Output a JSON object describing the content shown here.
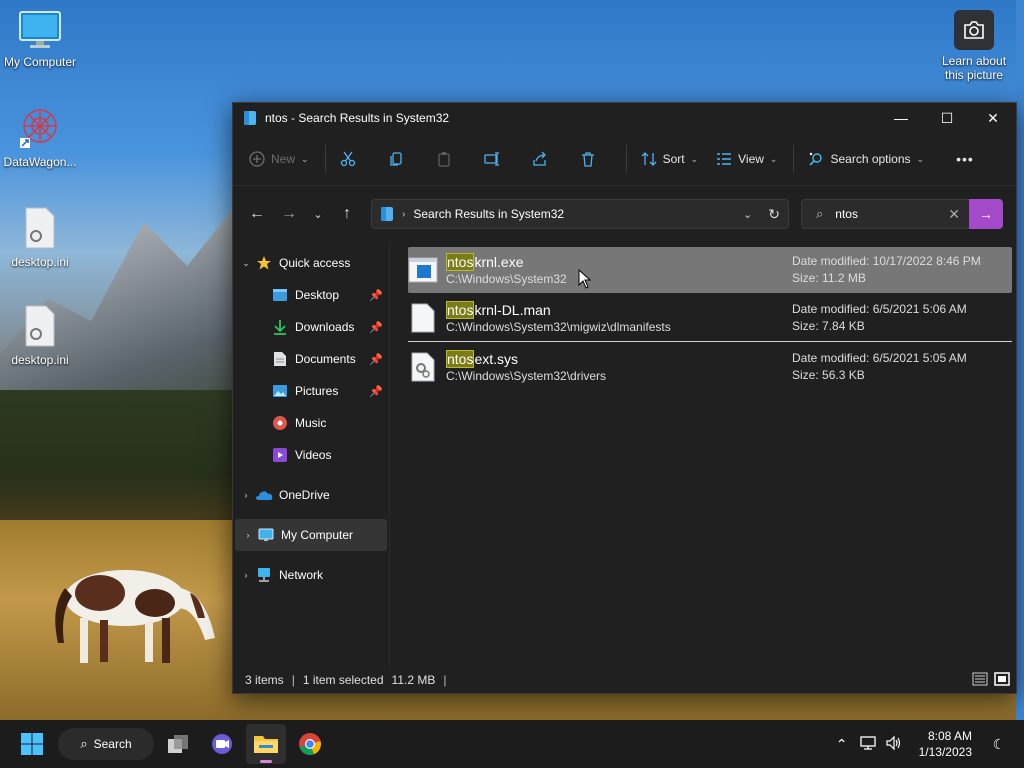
{
  "desktop": {
    "icons": [
      {
        "label": "My Computer",
        "icon": "monitor-icon"
      },
      {
        "label": "DataWagon...",
        "icon": "datawagon-shortcut-icon"
      },
      {
        "label": "desktop.ini",
        "icon": "settings-file-icon"
      },
      {
        "label": "desktop.ini",
        "icon": "settings-file-icon"
      }
    ],
    "learn_about": "Learn about this picture"
  },
  "window": {
    "title": "ntos - Search Results in System32",
    "controls": {
      "minimize": "—",
      "maximize": "☐",
      "close": "✕"
    }
  },
  "toolbar": {
    "new_label": "New",
    "sort_label": "Sort",
    "view_label": "View",
    "search_options_label": "Search options",
    "more_label": "•••"
  },
  "address": {
    "path": "Search Results in System32"
  },
  "search": {
    "query": "ntos"
  },
  "nav": {
    "items": [
      {
        "label": "Quick access",
        "icon": "star-icon",
        "expand": "⌄"
      },
      {
        "label": "Desktop",
        "icon": "desktop-folder-icon",
        "pinned": "📌"
      },
      {
        "label": "Downloads",
        "icon": "download-icon",
        "pinned": "📌"
      },
      {
        "label": "Documents",
        "icon": "document-icon",
        "pinned": "📌"
      },
      {
        "label": "Pictures",
        "icon": "pictures-icon",
        "pinned": "📌"
      },
      {
        "label": "Music",
        "icon": "music-icon"
      },
      {
        "label": "Videos",
        "icon": "videos-icon"
      },
      {
        "label": "OneDrive",
        "icon": "onedrive-icon",
        "expand": "›"
      },
      {
        "label": "My Computer",
        "icon": "monitor-icon",
        "expand": "›"
      },
      {
        "label": "Network",
        "icon": "network-icon",
        "expand": "›"
      }
    ]
  },
  "results": [
    {
      "highlight": "ntos",
      "rest": "krnl.exe",
      "path": "C:\\Windows\\System32",
      "date_label": "Date modified:",
      "date": "10/17/2022 8:46 PM",
      "size_label": "Size:",
      "size": "11.2 MB"
    },
    {
      "highlight": "ntos",
      "rest": "krnl-DL.man",
      "path": "C:\\Windows\\System32\\migwiz\\dlmanifests",
      "date_label": "Date modified:",
      "date": "6/5/2021 5:06 AM",
      "size_label": "Size:",
      "size": "7.84 KB"
    },
    {
      "highlight": "ntos",
      "rest": "ext.sys",
      "path": "C:\\Windows\\System32\\drivers",
      "date_label": "Date modified:",
      "date": "6/5/2021 5:05 AM",
      "size_label": "Size:",
      "size": "56.3 KB"
    }
  ],
  "status": {
    "items": "3 items",
    "selected": "1 item selected",
    "size": "11.2 MB"
  },
  "taskbar": {
    "search_label": "Search",
    "time": "8:08 AM",
    "date": "1/13/2023"
  },
  "colors": {
    "accent": "#a349c9",
    "highlight": "#7c7c16",
    "selection": "#777777"
  }
}
